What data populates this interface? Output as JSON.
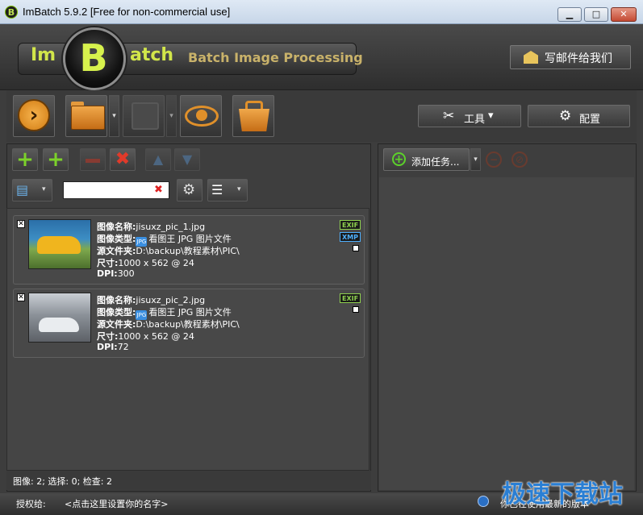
{
  "window": {
    "title": "ImBatch 5.9.2 [Free for non-commercial use]",
    "icon_letter": "B",
    "minimize": "▁",
    "maximize": "□",
    "close": "✕"
  },
  "header": {
    "logo_im": "Im",
    "logo_b": "B",
    "logo_atch": "atch",
    "logo_subtitle": "Batch Image Processing",
    "email_button": "写邮件给我们"
  },
  "toolbar": {
    "tools_button": "工具",
    "config_button": "配置",
    "tools_arrow": "▾",
    "go_glyph": "›"
  },
  "left_toolbar": {
    "search_value": "",
    "clear_glyph": "✖"
  },
  "images": [
    {
      "label_name": "图像名称:",
      "name": "jisuxz_pic_1.jpg",
      "label_type": "图像类型:",
      "type_icon": "JPG",
      "type": "看图王 JPG 图片文件",
      "label_folder": "源文件夹:",
      "folder": "D:\\backup\\教程素材\\PIC\\",
      "label_size": "尺寸:",
      "size": "1000 x 562 @ 24",
      "label_dpi": "DPI:",
      "dpi": "300",
      "badges": [
        "EXIF",
        "XMP"
      ]
    },
    {
      "label_name": "图像名称:",
      "name": "jisuxz_pic_2.jpg",
      "label_type": "图像类型:",
      "type_icon": "JPG",
      "type": "看图王 JPG 图片文件",
      "label_folder": "源文件夹:",
      "folder": "D:\\backup\\教程素材\\PIC\\",
      "label_size": "尺寸:",
      "size": "1000 x 562 @ 24",
      "label_dpi": "DPI:",
      "dpi": "72",
      "badges": [
        "EXIF"
      ]
    }
  ],
  "left_status": "图像: 2; 选择: 0; 检查: 2",
  "right_panel": {
    "add_task_button": "添加任务...",
    "add_glyph": "+",
    "remove_glyph": "−",
    "block_glyph": "⊘"
  },
  "statusbar": {
    "license_label": "授权给:",
    "license_value": "<点击这里设置你的名字>",
    "version_status": "你已在使用最新的版本"
  },
  "watermark": "极速下载站",
  "colors": {
    "accent_green": "#7cd22a",
    "accent_orange": "#e0902a",
    "logo_yellow": "#d2e64a",
    "panel_bg": "#3e3e3e"
  }
}
